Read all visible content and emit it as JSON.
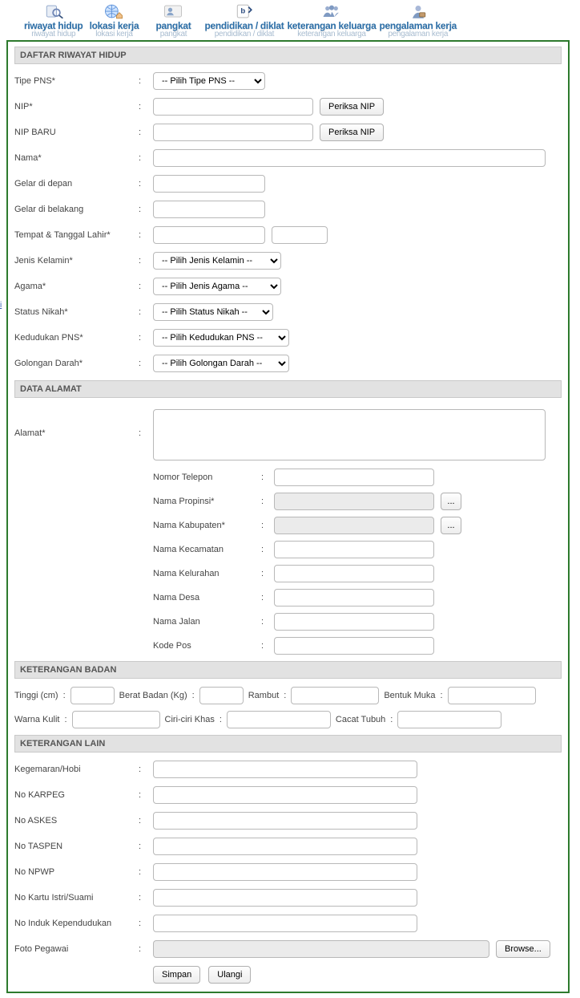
{
  "nav": [
    {
      "label": "riwayat hidup",
      "sub": "riwayat hidup"
    },
    {
      "label": "lokasi kerja",
      "sub": "lokasi kerja"
    },
    {
      "label": "pangkat",
      "sub": "pangkat"
    },
    {
      "label": "pendidikan / diklat",
      "sub": "pendidikan / diklat"
    },
    {
      "label": "keterangan keluarga",
      "sub": "keterangan keluarga"
    },
    {
      "label": "pengalaman kerja",
      "sub": "pengalaman kerja"
    }
  ],
  "left_link": "i",
  "sections": {
    "riwayat": "DAFTAR RIWAYAT HIDUP",
    "alamat": "DATA ALAMAT",
    "badan": "KETERANGAN BADAN",
    "lain": "KETERANGAN LAIN"
  },
  "labels": {
    "tipe_pns": "Tipe PNS*",
    "nip": "NIP*",
    "nip_baru": "NIP BARU",
    "nama": "Nama*",
    "gelar_depan": "Gelar di depan",
    "gelar_belakang": "Gelar di belakang",
    "ttl": "Tempat & Tanggal Lahir*",
    "jk": "Jenis Kelamin*",
    "agama": "Agama*",
    "status_nikah": "Status Nikah*",
    "kedudukan": "Kedudukan PNS*",
    "goldar": "Golongan Darah*",
    "alamat": "Alamat*",
    "telepon": "Nomor Telepon",
    "propinsi": "Nama Propinsi*",
    "kabupaten": "Nama Kabupaten*",
    "kecamatan": "Nama Kecamatan",
    "kelurahan": "Nama Kelurahan",
    "desa": "Nama Desa",
    "jalan": "Nama Jalan",
    "kodepos": "Kode Pos",
    "tinggi": "Tinggi (cm)",
    "berat": "Berat Badan (Kg)",
    "rambut": "Rambut",
    "bentuk_muka": "Bentuk Muka",
    "warna_kulit": "Warna Kulit",
    "ciri": "Ciri-ciri Khas",
    "cacat": "Cacat Tubuh",
    "hobi": "Kegemaran/Hobi",
    "karpeg": "No KARPEG",
    "askes": "No ASKES",
    "taspen": "No TASPEN",
    "npwp": "No NPWP",
    "kartu": "No Kartu Istri/Suami",
    "nik": "No Induk Kependudukan",
    "foto": "Foto Pegawai"
  },
  "selects": {
    "tipe_pns": "-- Pilih Tipe PNS --",
    "jk": "-- Pilih Jenis Kelamin --",
    "agama": "-- Pilih Jenis Agama --",
    "status_nikah": "-- Pilih Status Nikah --",
    "kedudukan": "-- Pilih Kedudukan PNS --",
    "goldar": "-- Pilih Golongan Darah --"
  },
  "buttons": {
    "periksa_nip": "Periksa NIP",
    "browse": "Browse...",
    "lookup": "...",
    "simpan": "Simpan",
    "ulangi": "Ulangi"
  },
  "colon": ":"
}
